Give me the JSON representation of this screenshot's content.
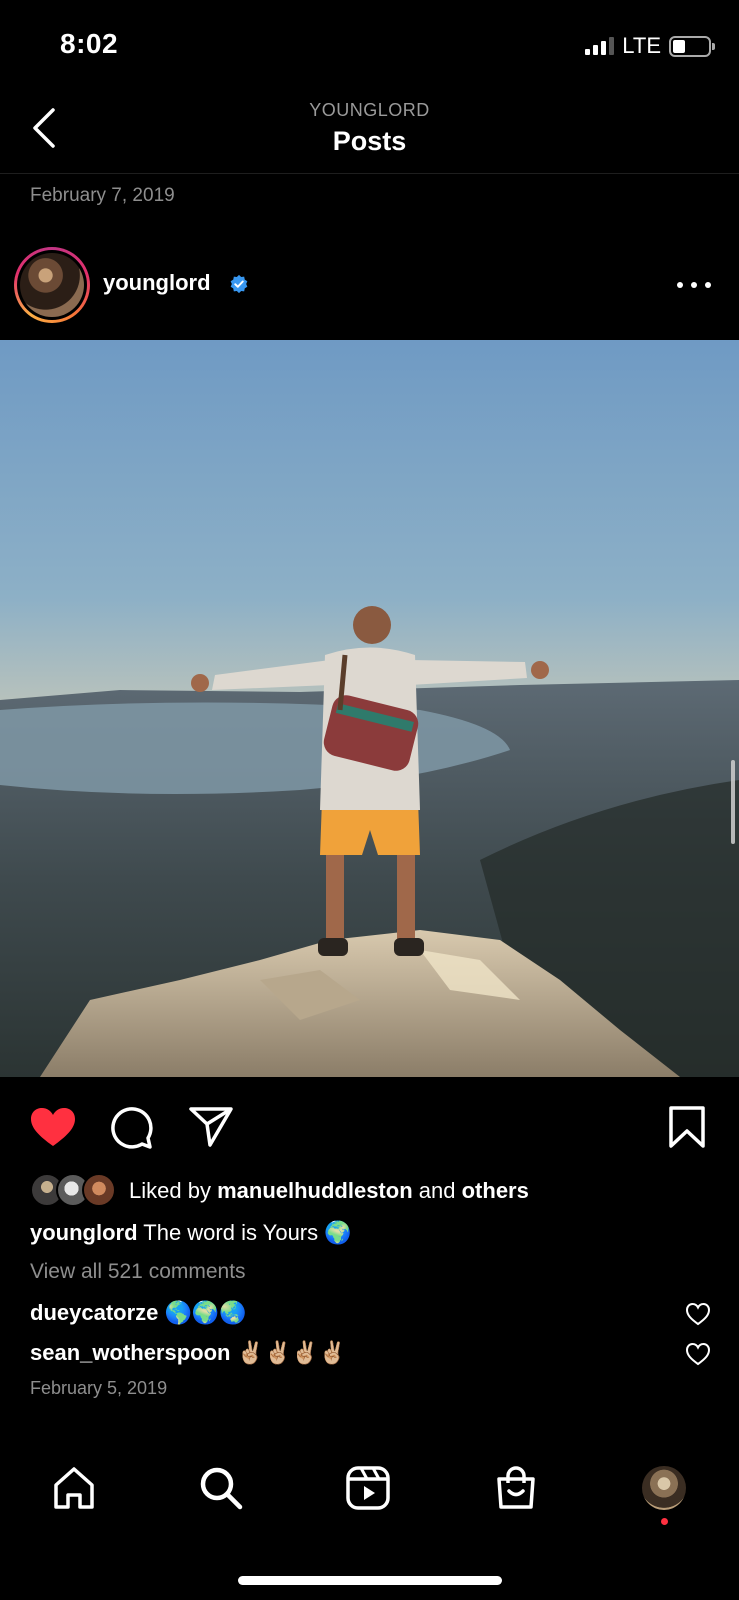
{
  "status_bar": {
    "time": "8:02",
    "network": "LTE"
  },
  "header": {
    "account": "YOUNGLORD",
    "title": "Posts"
  },
  "date_top": "February 7, 2019",
  "post": {
    "username": "younglord",
    "likes": {
      "prefix": "Liked by",
      "user": "manuelhuddleston",
      "joiner": "and",
      "others": "others"
    },
    "caption": {
      "username": "younglord",
      "text": "The word is Yours 🌍"
    },
    "view_comments": "View all 521 comments",
    "comments": [
      {
        "username": "dueycatorze",
        "text": "🌎🌍🌏"
      },
      {
        "username": "sean_wotherspoon",
        "text": "✌🏼✌🏼✌🏼✌🏼"
      }
    ],
    "date": "February 5, 2019"
  },
  "colors": {
    "like_red": "#ff3040",
    "verified_blue": "#3897f0",
    "muted": "#8e8e8e"
  },
  "icons": [
    "back-icon",
    "verified-icon",
    "more-icon",
    "heart-icon",
    "comment-icon",
    "share-icon",
    "bookmark-icon",
    "home-icon",
    "search-icon",
    "reels-icon",
    "shop-icon"
  ]
}
